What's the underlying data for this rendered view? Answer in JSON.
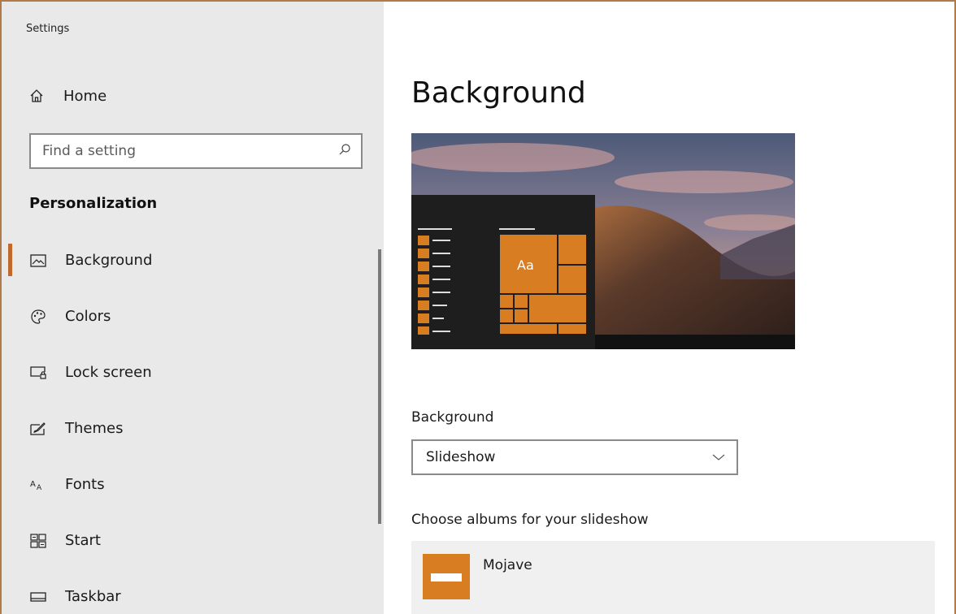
{
  "window": {
    "title": "Settings",
    "controls": [
      "minimize",
      "maximize",
      "close"
    ]
  },
  "sidebar": {
    "home_label": "Home",
    "search_placeholder": "Find a setting",
    "section_title": "Personalization",
    "items": [
      {
        "label": "Background",
        "icon": "picture-icon",
        "active": true
      },
      {
        "label": "Colors",
        "icon": "palette-icon",
        "active": false
      },
      {
        "label": "Lock screen",
        "icon": "lock-screen-icon",
        "active": false
      },
      {
        "label": "Themes",
        "icon": "brush-icon",
        "active": false
      },
      {
        "label": "Fonts",
        "icon": "fonts-icon",
        "active": false
      },
      {
        "label": "Start",
        "icon": "start-tiles-icon",
        "active": false
      },
      {
        "label": "Taskbar",
        "icon": "taskbar-icon",
        "active": false
      }
    ]
  },
  "main": {
    "page_title": "Background",
    "preview": {
      "sample_text": "Aa",
      "accent": "#d97d22"
    },
    "background_label": "Background",
    "background_value": "Slideshow",
    "albums_label": "Choose albums for your slideshow",
    "album_name": "Mojave"
  }
}
